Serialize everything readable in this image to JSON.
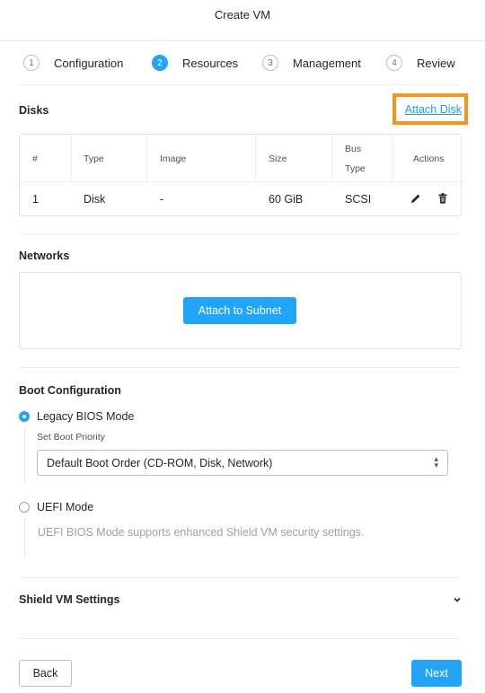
{
  "title": "Create VM",
  "steps": [
    {
      "number": "1",
      "label": "Configuration",
      "state": "inactive"
    },
    {
      "number": "2",
      "label": "Resources",
      "state": "active"
    },
    {
      "number": "3",
      "label": "Management",
      "state": "inactive"
    },
    {
      "number": "4",
      "label": "Review",
      "state": "inactive"
    }
  ],
  "disks": {
    "title": "Disks",
    "attach_label": "Attach Disk",
    "columns": [
      "#",
      "Type",
      "Image",
      "Size",
      "Bus Type",
      "Actions"
    ],
    "rows": [
      {
        "num": "1",
        "type": "Disk",
        "image": "-",
        "size": "60 GiB",
        "bus": "SCSI",
        "actions": [
          "pencil-icon",
          "trash-icon"
        ]
      }
    ]
  },
  "networks": {
    "title": "Networks",
    "attach_label": "Attach to Subnet"
  },
  "boot": {
    "title": "Boot Configuration",
    "legacy_label": "Legacy BIOS Mode",
    "legacy_selected": true,
    "priority_label": "Set Boot Priority",
    "priority_value": "Default Boot Order (CD-ROM, Disk, Network)",
    "uefi_label": "UEFI Mode",
    "uefi_selected": false,
    "uefi_hint": "UEFI BIOS Mode supports enhanced Shield VM security settings."
  },
  "shield": {
    "title": "Shield VM Settings",
    "icon": "chevron-down-icon"
  },
  "footer": {
    "back_label": "Back",
    "next_label": "Next"
  },
  "colors": {
    "accent": "#22a5f7",
    "highlight": "#f7941d",
    "link": "#1b9cf0"
  }
}
